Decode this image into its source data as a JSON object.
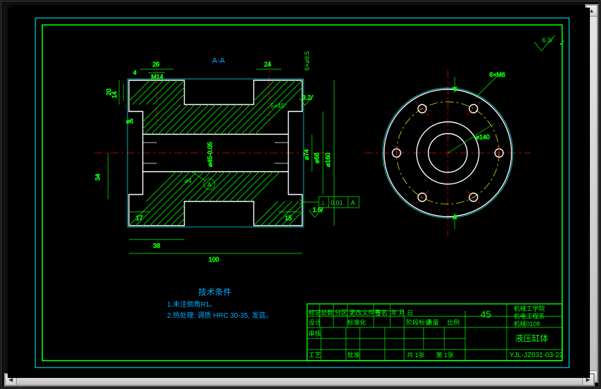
{
  "domain": "Computer-Use",
  "app": {
    "kind": "CAD drawing viewport"
  },
  "section_label": "A-A",
  "tech_notes": {
    "title": "技术条件",
    "line1": "1.未注倒角R1。",
    "line2": "2.热处理: 调质 HRC 30-35, 发蓝。"
  },
  "gcontrol": {
    "frame1": "⟂ 0.01 A",
    "datum": "A"
  },
  "surface_marks": [
    "1.6/",
    "3.2/",
    "6.3/"
  ],
  "dimensions": {
    "left_view": [
      "26",
      "M14",
      "4",
      "20",
      "14",
      "⌀6",
      "17",
      "34",
      "38",
      "⌀4",
      "100",
      "24",
      "15",
      "⌀74",
      "⌀45-0.05",
      "⌀68",
      "⌀160",
      "5×45°",
      "6×⌀9.5"
    ],
    "right_view": [
      "6×M6",
      "⌀140"
    ]
  },
  "title_block": {
    "headers": {
      "r1": [
        "标记",
        "处数",
        "分区",
        "更改文件号",
        "签名",
        "年 月 日"
      ],
      "r2": [
        "设计",
        "",
        "标准化",
        "",
        "",
        "",
        "阶段标记",
        "重量",
        "比例"
      ],
      "r3": [
        "审核",
        "",
        "",
        "",
        "",
        "",
        ""
      ],
      "r4": [
        "工艺",
        "",
        "批准",
        "",
        "",
        "共 1张",
        "第 1张",
        ""
      ]
    },
    "material": "45",
    "scale": "",
    "part_name": "液压缸体",
    "institution": [
      "机械工学院",
      "机电工程系",
      "机械0108"
    ],
    "drawing_no": "YJL-JZ031-03-22"
  },
  "top_right_symbol": "⟂"
}
